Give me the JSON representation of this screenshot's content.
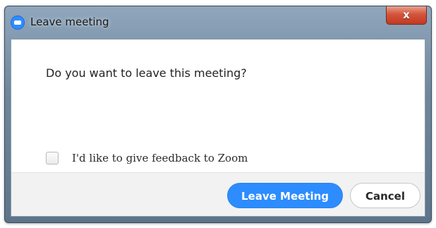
{
  "window": {
    "title": "Leave meeting",
    "app_icon": "zoom-logo-icon",
    "close_glyph": "x",
    "close_icon": "close-icon"
  },
  "dialog": {
    "message": "Do you want to leave this meeting?",
    "feedback_label": "I'd like to give feedback to Zoom",
    "feedback_checked": false
  },
  "actions": {
    "leave_label": "Leave Meeting",
    "cancel_label": "Cancel"
  },
  "colors": {
    "primary": "#2d8cff",
    "close_button": "#c13a22",
    "footer_bg": "#f2f2f2"
  }
}
